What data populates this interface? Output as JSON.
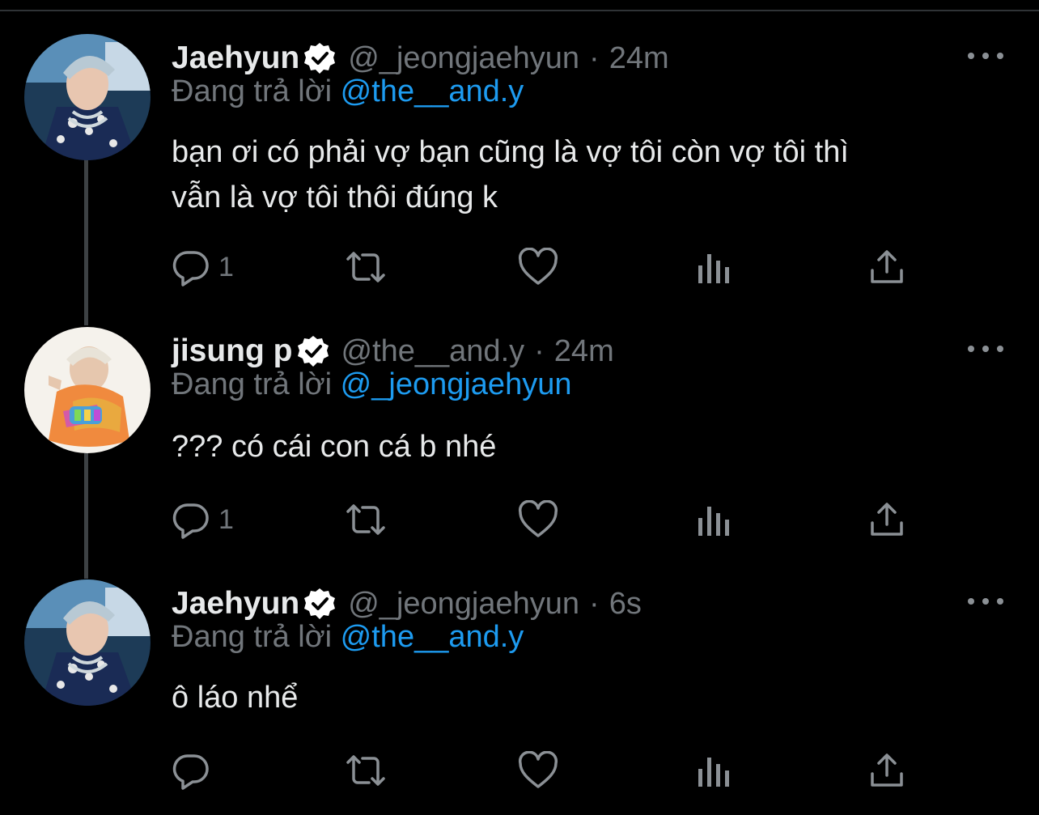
{
  "tweets": [
    {
      "display_name": "Jaehyun",
      "handle": "@_jeongjaehyun",
      "separator": "·",
      "time": "24m",
      "replying_label": "Đang trả lời",
      "replying_to": "@the__and.y",
      "text_line1": "bạn ơi có phải vợ bạn cũng là vợ tôi còn vợ tôi thì",
      "text_line2": "vẫn là vợ tôi thôi đúng k",
      "reply_count": "1"
    },
    {
      "display_name": "jisung p",
      "handle": "@the__and.y",
      "separator": "·",
      "time": "24m",
      "replying_label": "Đang trả lời",
      "replying_to": "@_jeongjaehyun",
      "text_line1": "??? có cái con cá b nhé",
      "reply_count": "1"
    },
    {
      "display_name": "Jaehyun",
      "handle": "@_jeongjaehyun",
      "separator": "·",
      "time": "6s",
      "replying_label": "Đang trả lời",
      "replying_to": "@the__and.y",
      "text_line1": "ô láo nhể",
      "reply_count": ""
    }
  ],
  "colors": {
    "background": "#000000",
    "text_primary": "#e7e9ea",
    "text_secondary": "#71767b",
    "accent": "#1d9bf0",
    "thread_line": "#3d4144"
  },
  "icons": [
    "verified-badge-icon",
    "more-dots-icon",
    "reply-icon",
    "retweet-icon",
    "like-icon",
    "analytics-icon",
    "share-icon"
  ]
}
